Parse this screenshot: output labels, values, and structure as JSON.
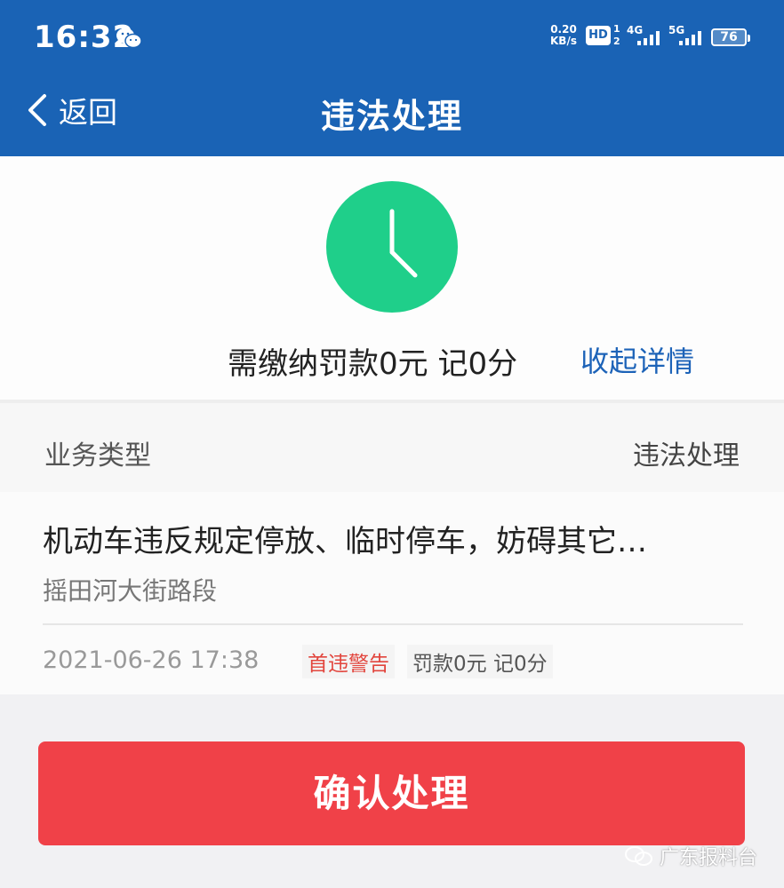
{
  "status_bar": {
    "time": "16:32",
    "net_speed_value": "0.20",
    "net_speed_unit": "KB/s",
    "hd_label": "HD",
    "hd_sup": "1",
    "hd_sub": "2",
    "signal_1": "4G",
    "signal_2": "5G",
    "battery": "76"
  },
  "nav": {
    "back_label": "返回",
    "title": "违法处理"
  },
  "summary": {
    "fine_text": "需缴纳罚款0元 记0分",
    "collapse_label": "收起详情"
  },
  "business": {
    "label": "业务类型",
    "value": "违法处理"
  },
  "record": {
    "title": "机动车违反规定停放、临时停车，妨碍其它…",
    "location": "摇田河大街路段",
    "datetime": "2021-06-26 17:38",
    "warning_badge": "首违警告",
    "penalty": "罚款0元 记0分"
  },
  "actions": {
    "confirm_label": "确认处理"
  },
  "watermark": {
    "text": "广东报料台"
  },
  "colors": {
    "header_blue": "#1a63b5",
    "clock_green": "#1fcf8a",
    "link_blue": "#1d63b8",
    "confirm_red": "#f04148",
    "warning_red": "#e2453d"
  }
}
